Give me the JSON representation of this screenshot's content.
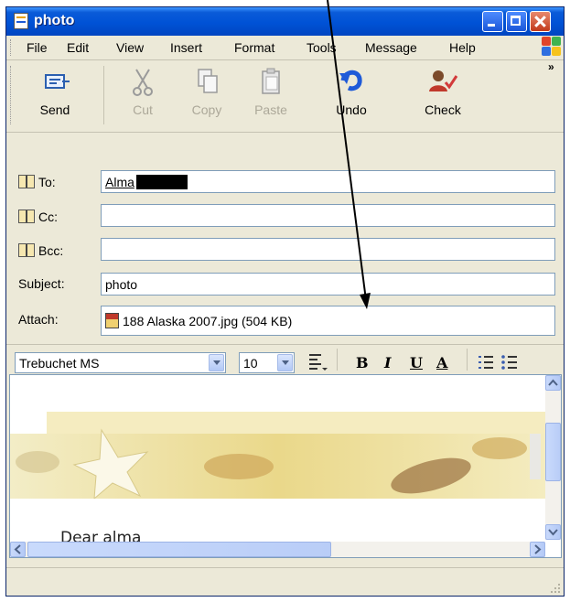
{
  "window": {
    "title": "photo"
  },
  "menu": [
    {
      "label": "File"
    },
    {
      "label": "Edit"
    },
    {
      "label": "View"
    },
    {
      "label": "Insert"
    },
    {
      "label": "Format"
    },
    {
      "label": "Tools"
    },
    {
      "label": "Message"
    },
    {
      "label": "Help"
    }
  ],
  "toolbar": {
    "send": "Send",
    "cut": "Cut",
    "copy": "Copy",
    "paste": "Paste",
    "undo": "Undo",
    "check": "Check",
    "overflow": "»"
  },
  "header": {
    "to_label": "To:",
    "to_value": "Alma",
    "cc_label": "Cc:",
    "cc_value": "",
    "bcc_label": "Bcc:",
    "bcc_value": "",
    "subject_label": "Subject:",
    "subject_value": "photo",
    "attach_label": "Attach:",
    "attachment": "188 Alaska 2007.jpg (504 KB)"
  },
  "format": {
    "font": "Trebuchet MS",
    "size": "10",
    "bold": "B",
    "italic": "I",
    "underline": "U",
    "color": "A"
  },
  "body": {
    "greeting": "Dear alma"
  },
  "colors": {
    "titlebar": "#0052d6",
    "chrome": "#ece9d8",
    "border": "#7f9db9"
  }
}
